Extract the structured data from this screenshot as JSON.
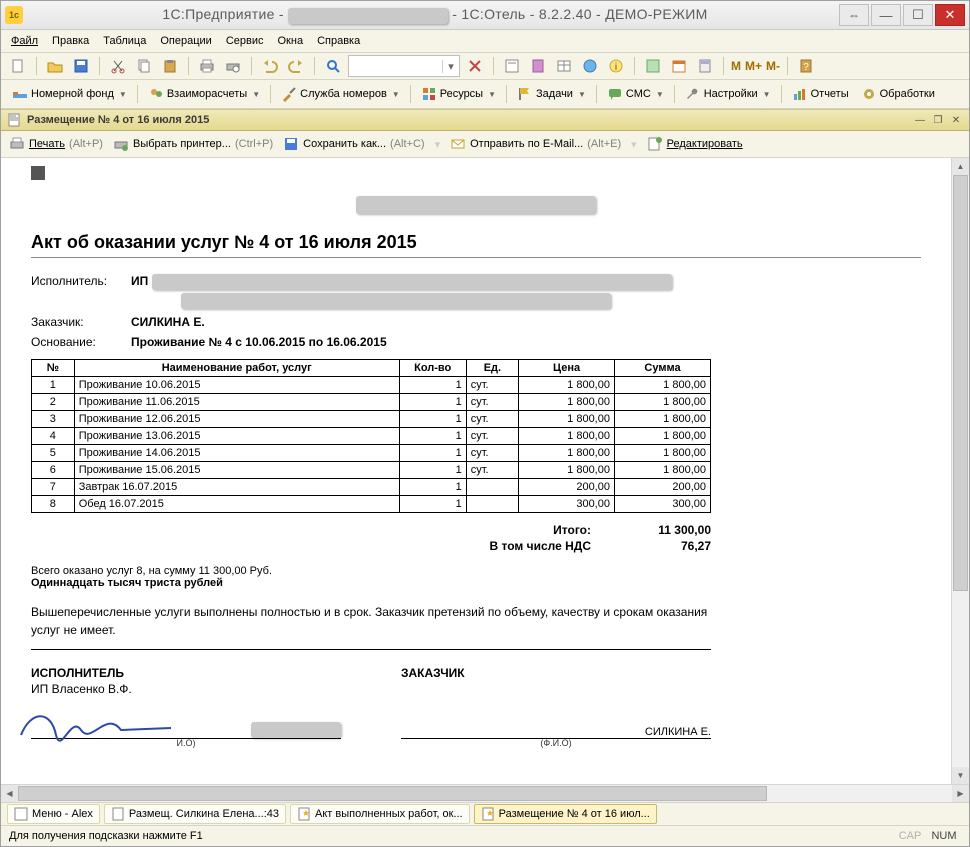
{
  "window": {
    "title_prefix": "1С:Предприятие - ",
    "title_suffix": " - 1С:Отель - 8.2.2.40 - ДЕМО-РЕЖИМ"
  },
  "menu": {
    "file": "Файл",
    "edit": "Правка",
    "table": "Таблица",
    "operations": "Операции",
    "service": "Сервис",
    "windows": "Окна",
    "help": "Справка"
  },
  "toolbar_text": {
    "m": "M",
    "mplus": "M+",
    "mminus": "M-"
  },
  "toolbar2": {
    "rooms": "Номерной фонд",
    "mutual": "Взаиморасчеты",
    "roomservice": "Служба номеров",
    "resources": "Ресурсы",
    "tasks": "Задачи",
    "sms": "СМС",
    "settings": "Настройки",
    "reports": "Отчеты",
    "processing": "Обработки"
  },
  "mdi": {
    "title": "Размещение № 4 от 16 июля 2015"
  },
  "doc_toolbar": {
    "print": "Печать",
    "print_sc": "(Alt+P)",
    "choose_printer": "Выбрать принтер...",
    "choose_printer_sc": "(Ctrl+P)",
    "save_as": "Сохранить как...",
    "save_as_sc": "(Alt+C)",
    "send_email": "Отправить по E-Mail...",
    "send_email_sc": "(Alt+E)",
    "edit": "Редактировать"
  },
  "doc": {
    "title": "Акт об оказании услуг № 4 от 16 июля 2015",
    "executor_label": "Исполнитель:",
    "executor_prefix": "ИП ",
    "customer_label": "Заказчик:",
    "customer": "СИЛКИНА Е.",
    "basis_label": "Основание:",
    "basis": "Проживание № 4 с 10.06.2015 по 16.06.2015",
    "columns": {
      "no": "№",
      "name": "Наименование работ, услуг",
      "qty": "Кол-во",
      "unit": "Ед.",
      "price": "Цена",
      "sum": "Сумма"
    },
    "rows": [
      {
        "no": "1",
        "name": "Проживание 10.06.2015",
        "qty": "1",
        "unit": "сут.",
        "price": "1 800,00",
        "sum": "1 800,00"
      },
      {
        "no": "2",
        "name": "Проживание 11.06.2015",
        "qty": "1",
        "unit": "сут.",
        "price": "1 800,00",
        "sum": "1 800,00"
      },
      {
        "no": "3",
        "name": "Проживание 12.06.2015",
        "qty": "1",
        "unit": "сут.",
        "price": "1 800,00",
        "sum": "1 800,00"
      },
      {
        "no": "4",
        "name": "Проживание 13.06.2015",
        "qty": "1",
        "unit": "сут.",
        "price": "1 800,00",
        "sum": "1 800,00"
      },
      {
        "no": "5",
        "name": "Проживание 14.06.2015",
        "qty": "1",
        "unit": "сут.",
        "price": "1 800,00",
        "sum": "1 800,00"
      },
      {
        "no": "6",
        "name": "Проживание 15.06.2015",
        "qty": "1",
        "unit": "сут.",
        "price": "1 800,00",
        "sum": "1 800,00"
      },
      {
        "no": "7",
        "name": "Завтрак 16.07.2015",
        "qty": "1",
        "unit": "",
        "price": "200,00",
        "sum": "200,00"
      },
      {
        "no": "8",
        "name": "Обед 16.07.2015",
        "qty": "1",
        "unit": "",
        "price": "300,00",
        "sum": "300,00"
      }
    ],
    "totals": {
      "itogo_label": "Итого:",
      "itogo": "11 300,00",
      "nds_label": "В том числе НДС",
      "nds": "76,27"
    },
    "summary_line": "Всего оказано услуг 8, на сумму 11 300,00 Руб.",
    "amount_words": "Одиннадцать тысяч триста рублей",
    "note": "Вышеперечисленные услуги выполнены полностью и в срок. Заказчик претензий по объему, качеству и срокам оказания услуг не имеет.",
    "sign": {
      "exec_role": "ИСПОЛНИТЕЛЬ",
      "exec_name": "ИП Власенко В.Ф.",
      "exec_hint": "И.О)",
      "cust_role": "ЗАКАЗЧИК",
      "cust_name": "СИЛКИНА Е.",
      "cust_hint": "(Ф.И.О)"
    }
  },
  "taskbar": {
    "t1": "Меню - Alex",
    "t2": "Размещ. Силкина Елена...:43",
    "t3": "Акт выполненных работ, ок...",
    "t4": "Размещение № 4 от 16 июл..."
  },
  "status": {
    "hint": "Для получения подсказки нажмите F1",
    "cap": "CAP",
    "num": "NUM"
  }
}
